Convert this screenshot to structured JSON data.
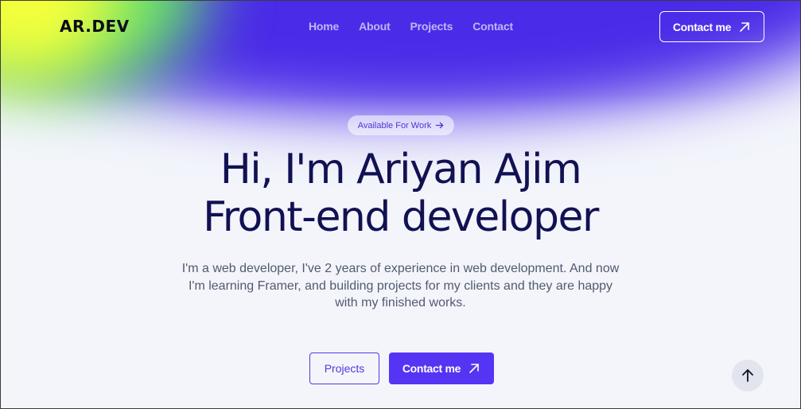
{
  "header": {
    "logo": "AR.DEV",
    "nav": [
      "Home",
      "About",
      "Projects",
      "Contact"
    ],
    "contact_label": "Contact me"
  },
  "hero": {
    "badge": "Available For Work",
    "title_line1": "Hi, I'm Ariyan Ajim",
    "title_line2": "Front-end developer",
    "intro": "I'm a web developer, I've 2 years of experience in web development. And now I'm learning Framer, and building projects for my clients and they are happy with my finished works.",
    "projects_label": "Projects",
    "contact_label": "Contact me"
  },
  "icons": {
    "arrow_up_right": "arrow-up-right-icon",
    "arrow_right": "arrow-right-icon",
    "arrow_up": "arrow-up-icon"
  },
  "colors": {
    "accent": "#5535f3",
    "heading": "#111153",
    "blue_glow": "#4a2be8",
    "green_glow": "#63e06b",
    "yellow_glow": "#f4ff3c"
  }
}
